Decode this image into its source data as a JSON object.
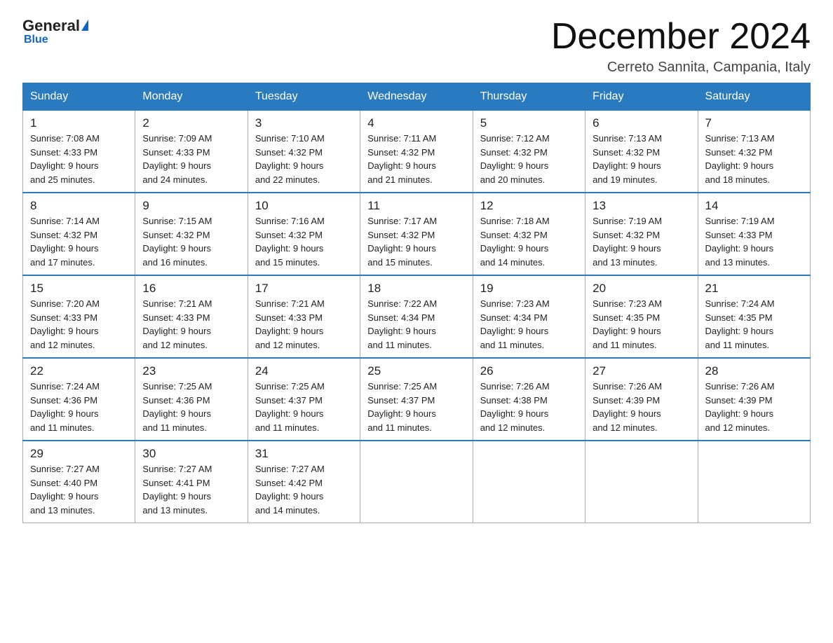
{
  "logo": {
    "general": "General",
    "blue": "Blue"
  },
  "title": "December 2024",
  "location": "Cerreto Sannita, Campania, Italy",
  "days_of_week": [
    "Sunday",
    "Monday",
    "Tuesday",
    "Wednesday",
    "Thursday",
    "Friday",
    "Saturday"
  ],
  "weeks": [
    [
      {
        "num": "1",
        "sunrise": "7:08 AM",
        "sunset": "4:33 PM",
        "daylight": "9 hours and 25 minutes."
      },
      {
        "num": "2",
        "sunrise": "7:09 AM",
        "sunset": "4:33 PM",
        "daylight": "9 hours and 24 minutes."
      },
      {
        "num": "3",
        "sunrise": "7:10 AM",
        "sunset": "4:32 PM",
        "daylight": "9 hours and 22 minutes."
      },
      {
        "num": "4",
        "sunrise": "7:11 AM",
        "sunset": "4:32 PM",
        "daylight": "9 hours and 21 minutes."
      },
      {
        "num": "5",
        "sunrise": "7:12 AM",
        "sunset": "4:32 PM",
        "daylight": "9 hours and 20 minutes."
      },
      {
        "num": "6",
        "sunrise": "7:13 AM",
        "sunset": "4:32 PM",
        "daylight": "9 hours and 19 minutes."
      },
      {
        "num": "7",
        "sunrise": "7:13 AM",
        "sunset": "4:32 PM",
        "daylight": "9 hours and 18 minutes."
      }
    ],
    [
      {
        "num": "8",
        "sunrise": "7:14 AM",
        "sunset": "4:32 PM",
        "daylight": "9 hours and 17 minutes."
      },
      {
        "num": "9",
        "sunrise": "7:15 AM",
        "sunset": "4:32 PM",
        "daylight": "9 hours and 16 minutes."
      },
      {
        "num": "10",
        "sunrise": "7:16 AM",
        "sunset": "4:32 PM",
        "daylight": "9 hours and 15 minutes."
      },
      {
        "num": "11",
        "sunrise": "7:17 AM",
        "sunset": "4:32 PM",
        "daylight": "9 hours and 15 minutes."
      },
      {
        "num": "12",
        "sunrise": "7:18 AM",
        "sunset": "4:32 PM",
        "daylight": "9 hours and 14 minutes."
      },
      {
        "num": "13",
        "sunrise": "7:19 AM",
        "sunset": "4:32 PM",
        "daylight": "9 hours and 13 minutes."
      },
      {
        "num": "14",
        "sunrise": "7:19 AM",
        "sunset": "4:33 PM",
        "daylight": "9 hours and 13 minutes."
      }
    ],
    [
      {
        "num": "15",
        "sunrise": "7:20 AM",
        "sunset": "4:33 PM",
        "daylight": "9 hours and 12 minutes."
      },
      {
        "num": "16",
        "sunrise": "7:21 AM",
        "sunset": "4:33 PM",
        "daylight": "9 hours and 12 minutes."
      },
      {
        "num": "17",
        "sunrise": "7:21 AM",
        "sunset": "4:33 PM",
        "daylight": "9 hours and 12 minutes."
      },
      {
        "num": "18",
        "sunrise": "7:22 AM",
        "sunset": "4:34 PM",
        "daylight": "9 hours and 11 minutes."
      },
      {
        "num": "19",
        "sunrise": "7:23 AM",
        "sunset": "4:34 PM",
        "daylight": "9 hours and 11 minutes."
      },
      {
        "num": "20",
        "sunrise": "7:23 AM",
        "sunset": "4:35 PM",
        "daylight": "9 hours and 11 minutes."
      },
      {
        "num": "21",
        "sunrise": "7:24 AM",
        "sunset": "4:35 PM",
        "daylight": "9 hours and 11 minutes."
      }
    ],
    [
      {
        "num": "22",
        "sunrise": "7:24 AM",
        "sunset": "4:36 PM",
        "daylight": "9 hours and 11 minutes."
      },
      {
        "num": "23",
        "sunrise": "7:25 AM",
        "sunset": "4:36 PM",
        "daylight": "9 hours and 11 minutes."
      },
      {
        "num": "24",
        "sunrise": "7:25 AM",
        "sunset": "4:37 PM",
        "daylight": "9 hours and 11 minutes."
      },
      {
        "num": "25",
        "sunrise": "7:25 AM",
        "sunset": "4:37 PM",
        "daylight": "9 hours and 11 minutes."
      },
      {
        "num": "26",
        "sunrise": "7:26 AM",
        "sunset": "4:38 PM",
        "daylight": "9 hours and 12 minutes."
      },
      {
        "num": "27",
        "sunrise": "7:26 AM",
        "sunset": "4:39 PM",
        "daylight": "9 hours and 12 minutes."
      },
      {
        "num": "28",
        "sunrise": "7:26 AM",
        "sunset": "4:39 PM",
        "daylight": "9 hours and 12 minutes."
      }
    ],
    [
      {
        "num": "29",
        "sunrise": "7:27 AM",
        "sunset": "4:40 PM",
        "daylight": "9 hours and 13 minutes."
      },
      {
        "num": "30",
        "sunrise": "7:27 AM",
        "sunset": "4:41 PM",
        "daylight": "9 hours and 13 minutes."
      },
      {
        "num": "31",
        "sunrise": "7:27 AM",
        "sunset": "4:42 PM",
        "daylight": "9 hours and 14 minutes."
      },
      null,
      null,
      null,
      null
    ]
  ],
  "labels": {
    "sunrise": "Sunrise:",
    "sunset": "Sunset:",
    "daylight": "Daylight:"
  }
}
